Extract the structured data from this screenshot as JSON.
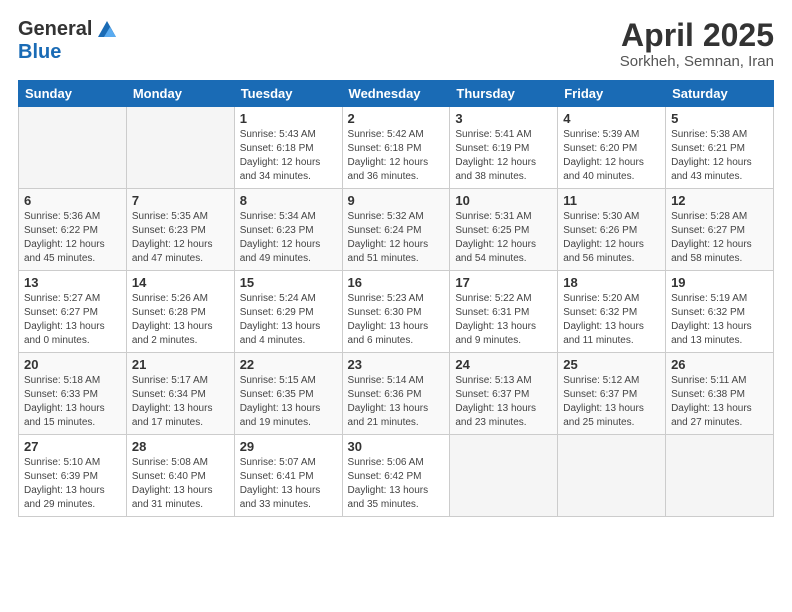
{
  "header": {
    "logo_general": "General",
    "logo_blue": "Blue",
    "title": "April 2025",
    "subtitle": "Sorkheh, Semnan, Iran"
  },
  "calendar": {
    "days_of_week": [
      "Sunday",
      "Monday",
      "Tuesday",
      "Wednesday",
      "Thursday",
      "Friday",
      "Saturday"
    ],
    "weeks": [
      [
        {
          "day": "",
          "info": ""
        },
        {
          "day": "",
          "info": ""
        },
        {
          "day": "1",
          "info": "Sunrise: 5:43 AM\nSunset: 6:18 PM\nDaylight: 12 hours and 34 minutes."
        },
        {
          "day": "2",
          "info": "Sunrise: 5:42 AM\nSunset: 6:18 PM\nDaylight: 12 hours and 36 minutes."
        },
        {
          "day": "3",
          "info": "Sunrise: 5:41 AM\nSunset: 6:19 PM\nDaylight: 12 hours and 38 minutes."
        },
        {
          "day": "4",
          "info": "Sunrise: 5:39 AM\nSunset: 6:20 PM\nDaylight: 12 hours and 40 minutes."
        },
        {
          "day": "5",
          "info": "Sunrise: 5:38 AM\nSunset: 6:21 PM\nDaylight: 12 hours and 43 minutes."
        }
      ],
      [
        {
          "day": "6",
          "info": "Sunrise: 5:36 AM\nSunset: 6:22 PM\nDaylight: 12 hours and 45 minutes."
        },
        {
          "day": "7",
          "info": "Sunrise: 5:35 AM\nSunset: 6:23 PM\nDaylight: 12 hours and 47 minutes."
        },
        {
          "day": "8",
          "info": "Sunrise: 5:34 AM\nSunset: 6:23 PM\nDaylight: 12 hours and 49 minutes."
        },
        {
          "day": "9",
          "info": "Sunrise: 5:32 AM\nSunset: 6:24 PM\nDaylight: 12 hours and 51 minutes."
        },
        {
          "day": "10",
          "info": "Sunrise: 5:31 AM\nSunset: 6:25 PM\nDaylight: 12 hours and 54 minutes."
        },
        {
          "day": "11",
          "info": "Sunrise: 5:30 AM\nSunset: 6:26 PM\nDaylight: 12 hours and 56 minutes."
        },
        {
          "day": "12",
          "info": "Sunrise: 5:28 AM\nSunset: 6:27 PM\nDaylight: 12 hours and 58 minutes."
        }
      ],
      [
        {
          "day": "13",
          "info": "Sunrise: 5:27 AM\nSunset: 6:27 PM\nDaylight: 13 hours and 0 minutes."
        },
        {
          "day": "14",
          "info": "Sunrise: 5:26 AM\nSunset: 6:28 PM\nDaylight: 13 hours and 2 minutes."
        },
        {
          "day": "15",
          "info": "Sunrise: 5:24 AM\nSunset: 6:29 PM\nDaylight: 13 hours and 4 minutes."
        },
        {
          "day": "16",
          "info": "Sunrise: 5:23 AM\nSunset: 6:30 PM\nDaylight: 13 hours and 6 minutes."
        },
        {
          "day": "17",
          "info": "Sunrise: 5:22 AM\nSunset: 6:31 PM\nDaylight: 13 hours and 9 minutes."
        },
        {
          "day": "18",
          "info": "Sunrise: 5:20 AM\nSunset: 6:32 PM\nDaylight: 13 hours and 11 minutes."
        },
        {
          "day": "19",
          "info": "Sunrise: 5:19 AM\nSunset: 6:32 PM\nDaylight: 13 hours and 13 minutes."
        }
      ],
      [
        {
          "day": "20",
          "info": "Sunrise: 5:18 AM\nSunset: 6:33 PM\nDaylight: 13 hours and 15 minutes."
        },
        {
          "day": "21",
          "info": "Sunrise: 5:17 AM\nSunset: 6:34 PM\nDaylight: 13 hours and 17 minutes."
        },
        {
          "day": "22",
          "info": "Sunrise: 5:15 AM\nSunset: 6:35 PM\nDaylight: 13 hours and 19 minutes."
        },
        {
          "day": "23",
          "info": "Sunrise: 5:14 AM\nSunset: 6:36 PM\nDaylight: 13 hours and 21 minutes."
        },
        {
          "day": "24",
          "info": "Sunrise: 5:13 AM\nSunset: 6:37 PM\nDaylight: 13 hours and 23 minutes."
        },
        {
          "day": "25",
          "info": "Sunrise: 5:12 AM\nSunset: 6:37 PM\nDaylight: 13 hours and 25 minutes."
        },
        {
          "day": "26",
          "info": "Sunrise: 5:11 AM\nSunset: 6:38 PM\nDaylight: 13 hours and 27 minutes."
        }
      ],
      [
        {
          "day": "27",
          "info": "Sunrise: 5:10 AM\nSunset: 6:39 PM\nDaylight: 13 hours and 29 minutes."
        },
        {
          "day": "28",
          "info": "Sunrise: 5:08 AM\nSunset: 6:40 PM\nDaylight: 13 hours and 31 minutes."
        },
        {
          "day": "29",
          "info": "Sunrise: 5:07 AM\nSunset: 6:41 PM\nDaylight: 13 hours and 33 minutes."
        },
        {
          "day": "30",
          "info": "Sunrise: 5:06 AM\nSunset: 6:42 PM\nDaylight: 13 hours and 35 minutes."
        },
        {
          "day": "",
          "info": ""
        },
        {
          "day": "",
          "info": ""
        },
        {
          "day": "",
          "info": ""
        }
      ]
    ]
  }
}
